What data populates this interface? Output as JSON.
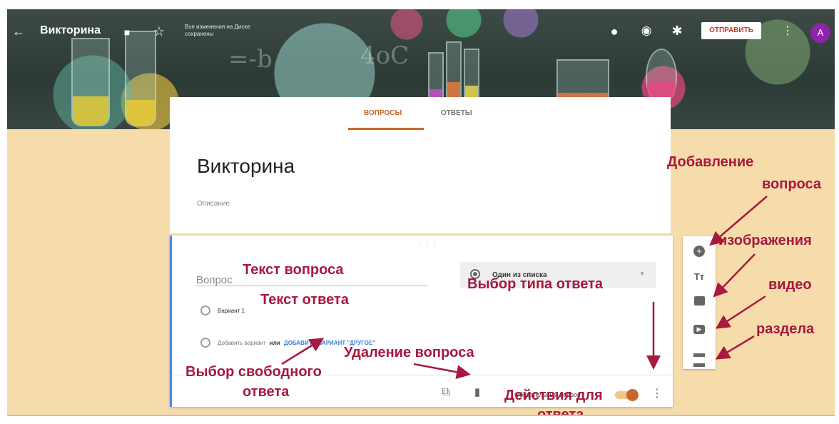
{
  "header": {
    "form_title": "Викторина",
    "save_status": "Все изменения на Диске сохранены",
    "send_label": "ОТПРАВИТЬ",
    "avatar_letter": "A",
    "icons": [
      "back-arrow-icon",
      "folder-icon",
      "star-icon",
      "palette-icon",
      "eye-icon",
      "gear-icon",
      "more-vert-icon"
    ]
  },
  "tabs": [
    {
      "label": "ВОПРОСЫ",
      "active": true
    },
    {
      "label": "ОТВЕТЫ",
      "active": false
    }
  ],
  "form": {
    "title": "Викторина",
    "description_placeholder": "Описание"
  },
  "question": {
    "title_placeholder": "Вопрос",
    "type_label": "Один из списка",
    "option1_label": "Вариант 1",
    "add_option_text": "Добавить вариант",
    "or_text": "или",
    "add_other_link": "ДОБАВИТЬ ВАРИАНТ \"ДРУГОЕ\"",
    "required_label": "Обязательный вопрос"
  },
  "annotations": {
    "question_text": "Текст вопроса",
    "answer_text": "Текст ответа",
    "answer_type": "Выбор типа ответа",
    "delete_question": "Удаление вопроса",
    "free_answer_line1": "Выбор свободного",
    "free_answer_line2": "ответа",
    "actions_line1": "Действия для",
    "actions_line2": "ответа",
    "add_line1": "Добавление",
    "add_line2": "вопроса",
    "images": "изображения",
    "video": "видео",
    "section": "раздела"
  },
  "colors": {
    "accent": "#c8692c",
    "annotation": "#a8183f",
    "question_border": "#4a86e8",
    "background": "#f6dcab",
    "avatar": "#8e24aa"
  }
}
